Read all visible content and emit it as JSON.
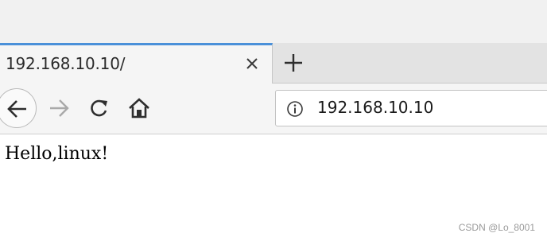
{
  "tab": {
    "title": "192.168.10.10/",
    "close_icon": "close-icon"
  },
  "new_tab": {
    "icon": "plus-icon"
  },
  "toolbar": {
    "back_icon": "arrow-left-icon",
    "forward_icon": "arrow-right-icon",
    "reload_icon": "reload-icon",
    "home_icon": "home-icon"
  },
  "address_bar": {
    "info_icon": "info-icon",
    "url": "192.168.10.10"
  },
  "page": {
    "body_text": "Hello,linux!"
  },
  "watermark": {
    "text": "CSDN @Lo_8001"
  },
  "colors": {
    "tab_accent": "#4a90d9",
    "tab_strip": "#e3e3e3",
    "toolbar": "#f5f5f5"
  }
}
